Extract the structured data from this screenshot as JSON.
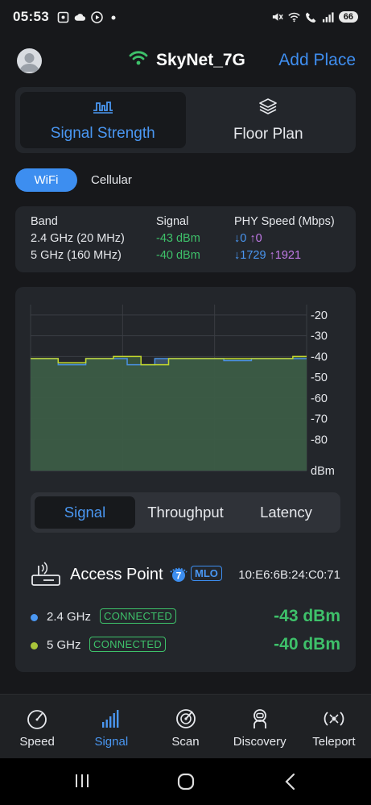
{
  "status_bar": {
    "time": "05:53",
    "battery": "66"
  },
  "header": {
    "network_name": "SkyNet_7G",
    "add_place": "Add Place"
  },
  "mode_tabs": [
    {
      "label": "Signal Strength",
      "icon": "signal-wave-icon",
      "active": true
    },
    {
      "label": "Floor Plan",
      "icon": "layers-icon",
      "active": false
    }
  ],
  "connection_toggle": {
    "wifi": "WiFi",
    "cellular": "Cellular",
    "selected": "WiFi"
  },
  "band_table": {
    "headers": [
      "Band",
      "Signal",
      "PHY Speed (Mbps)"
    ],
    "rows": [
      {
        "band": "2.4 GHz (20 MHz)",
        "signal": "-43 dBm",
        "down": "↓0",
        "up": "↑0"
      },
      {
        "band": "5 GHz (160 MHz)",
        "signal": "-40 dBm",
        "down": "↓1729",
        "up": "↑1921"
      }
    ]
  },
  "chart_data": {
    "type": "area",
    "yunit": "dBm",
    "ylim": [
      -95,
      -15
    ],
    "yticks": [
      "-20",
      "-30",
      "-40",
      "-50",
      "-60",
      "-70",
      "-80",
      "dBm"
    ],
    "grid": true,
    "series": [
      {
        "name": "2.4 GHz",
        "color": "#4a90e2",
        "values": [
          -41,
          -41,
          -44,
          -44,
          -41,
          -41,
          -41,
          -44,
          -44,
          -41,
          -41,
          -41,
          -41,
          -41,
          -42,
          -42,
          -41,
          -41,
          -41,
          -41
        ]
      },
      {
        "name": "5 GHz",
        "color": "#c4d82c",
        "values": [
          -41,
          -41,
          -43,
          -43,
          -41,
          -41,
          -40,
          -40,
          -44,
          -44,
          -41,
          -41,
          -41,
          -41,
          -41,
          -41,
          -41,
          -41,
          -41,
          -40
        ]
      }
    ]
  },
  "sub_tabs": [
    {
      "label": "Signal",
      "active": true
    },
    {
      "label": "Throughput",
      "active": false
    },
    {
      "label": "Latency",
      "active": false
    }
  ],
  "access_point": {
    "title": "Access Point",
    "wifi_gen": "7",
    "mlo": "MLO",
    "mac": "10:E6:6B:24:C0:71",
    "bands": [
      {
        "label": "2.4 GHz",
        "status": "CONNECTED",
        "rssi": "-43 dBm",
        "color": "#4a97f2"
      },
      {
        "label": "5 GHz",
        "status": "CONNECTED",
        "rssi": "-40 dBm",
        "color": "#a8c43a"
      }
    ]
  },
  "bottom_nav": [
    {
      "label": "Speed",
      "icon": "speedometer-icon",
      "active": false
    },
    {
      "label": "Signal",
      "icon": "signal-bars-icon",
      "active": true
    },
    {
      "label": "Scan",
      "icon": "radar-icon",
      "active": false
    },
    {
      "label": "Discovery",
      "icon": "astronaut-icon",
      "active": false
    },
    {
      "label": "Teleport",
      "icon": "teleport-icon",
      "active": false
    }
  ]
}
